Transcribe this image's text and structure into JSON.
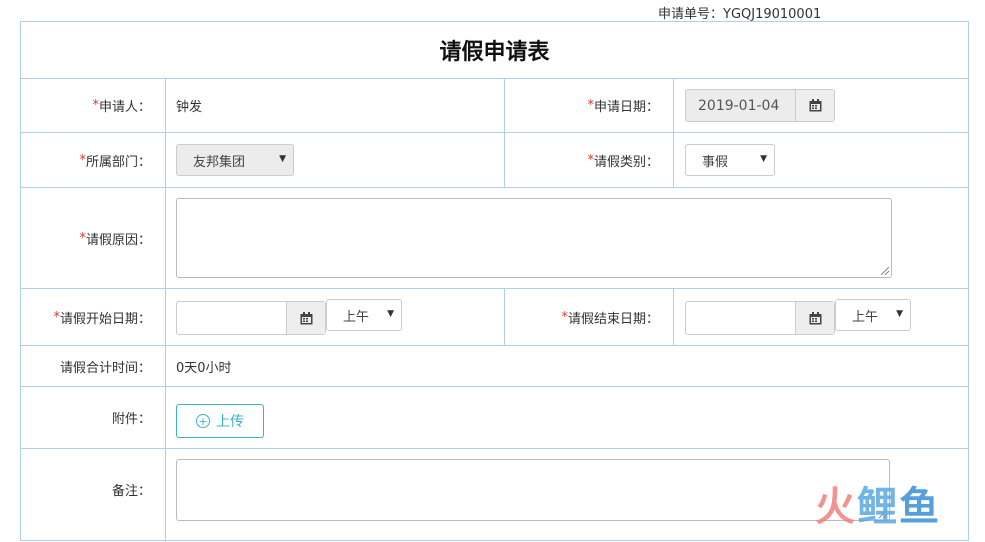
{
  "form_number": "申请单号：YGQJ19010001",
  "title": "请假申请表",
  "required_mark": "*",
  "fields": {
    "applicant": {
      "label": "申请人：",
      "value": "钟发"
    },
    "apply_date": {
      "label": "申请日期：",
      "value": "2019-01-04"
    },
    "department": {
      "label": "所属部门：",
      "value": "友邦集团"
    },
    "leave_type": {
      "label": "请假类别：",
      "value": "事假"
    },
    "reason": {
      "label": "请假原因：",
      "value": ""
    },
    "start_date": {
      "label": "请假开始日期：",
      "value": "",
      "period": "上午"
    },
    "end_date": {
      "label": "请假结束日期：",
      "value": "",
      "period": "上午"
    },
    "total_time": {
      "label": "请假合计时间：",
      "value": "0天0小时"
    },
    "attachment": {
      "label": "附件：",
      "button": "上传"
    },
    "remarks": {
      "label": "备注：",
      "value": ""
    }
  },
  "watermark": {
    "part1": "火",
    "part2": "鲤",
    "part3": "鱼"
  },
  "icons": {
    "calendar": "calendar-icon",
    "dropdown": "caret-down-icon",
    "upload": "plus-circle-icon"
  }
}
